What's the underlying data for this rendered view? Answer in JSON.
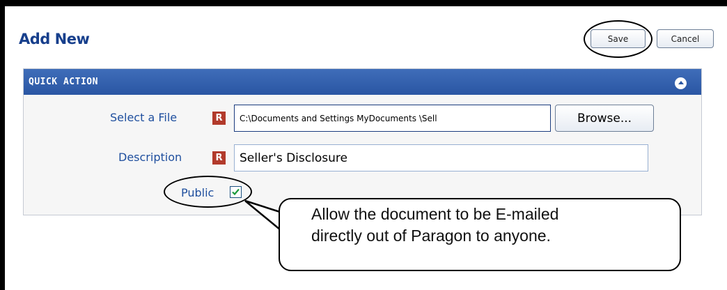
{
  "header": {
    "title": "Add New",
    "save_label": "Save",
    "cancel_label": "Cancel"
  },
  "panel": {
    "title": "QUICK ACTION",
    "fields": {
      "file": {
        "label": "Select a File",
        "required_marker": "R",
        "value": "C:\\Documents  and Settings MyDocuments \\Sell",
        "browse_label": "Browse..."
      },
      "description": {
        "label": "Description",
        "required_marker": "R",
        "value": "Seller's Disclosure"
      },
      "public": {
        "label": "Public",
        "checked": true
      }
    }
  },
  "callout": {
    "line1": "Allow the document to be E-mailed",
    "line2": "directly out of Paragon to anyone."
  },
  "colors": {
    "title": "#173f8c",
    "panel_header": "#2a56a3",
    "required_badge": "#b23a2b",
    "label": "#1f4f9e"
  }
}
